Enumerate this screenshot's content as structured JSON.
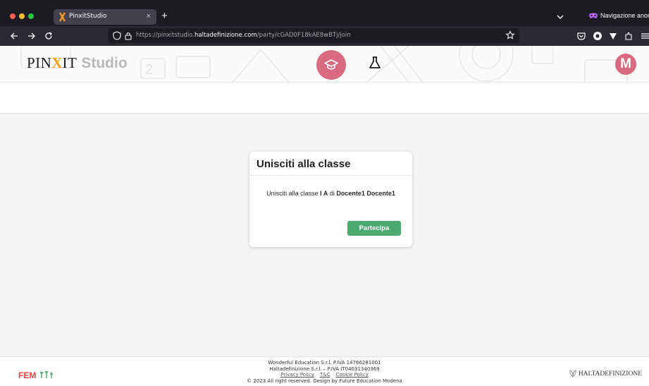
{
  "browser": {
    "tab_title": "PinxitStudio",
    "new_tab_label": "+",
    "close_label": "×",
    "private_label": "Navigazione anonima",
    "url_prefix": "https://pinxitstudio.",
    "url_domain": "haltadefinizione.com",
    "url_path": "/party/cGAD0F18kAE8wBTj/join"
  },
  "header": {
    "logo_pin": "PIN",
    "logo_x": "X",
    "logo_it": "IT",
    "logo_studio": "Studio",
    "avatar_initial": "M"
  },
  "card": {
    "title": "Unisciti alla classe",
    "body_prefix": "Unisciti alla classe ",
    "class_name": "I A",
    "body_mid": " di ",
    "teacher_name": "Docente1 Docente1",
    "join_label": "Partecipa"
  },
  "footer": {
    "line1": "Wonderful Education S.r.l. P.IVA 14766281001",
    "line2": "Haltadefinizione S.r.l. – P.IVA IT04031340369",
    "links": [
      "Privacy Policy",
      "T&C",
      "Cookie Policy"
    ],
    "line4": "© 2023 All right reserved. Design by Future Education Modena",
    "fem_logo": "FEM",
    "hd_logo": "HALTADEFINIZIONE"
  },
  "colors": {
    "accent_pink": "#d9697f",
    "join_green": "#4caa71",
    "logo_orange": "#f59b1c"
  }
}
